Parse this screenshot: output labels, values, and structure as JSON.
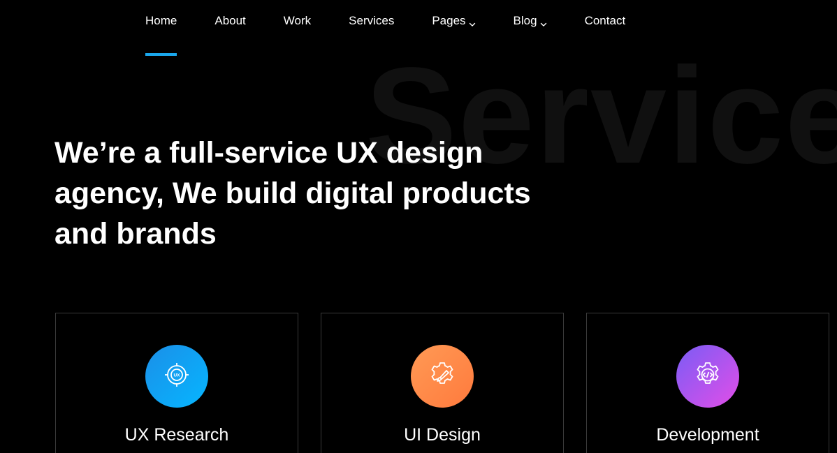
{
  "nav": {
    "items": [
      {
        "label": "Home",
        "active": true,
        "dropdown": false
      },
      {
        "label": "About",
        "active": false,
        "dropdown": false
      },
      {
        "label": "Work",
        "active": false,
        "dropdown": false
      },
      {
        "label": "Services",
        "active": false,
        "dropdown": false
      },
      {
        "label": "Pages",
        "active": false,
        "dropdown": true
      },
      {
        "label": "Blog",
        "active": false,
        "dropdown": true
      },
      {
        "label": "Contact",
        "active": false,
        "dropdown": false
      }
    ],
    "accent_color": "#1aa7ec"
  },
  "hero": {
    "watermark": "Services",
    "title": "We’re a full-service UX design agency, We build digital products and brands"
  },
  "services": [
    {
      "title": "UX Research",
      "icon": "ux-target-icon",
      "gradient": [
        "#1b8fe8",
        "#06b6ff"
      ]
    },
    {
      "title": "UI Design",
      "icon": "gear-brush-icon",
      "gradient": [
        "#ff9a55",
        "#ff7a3d"
      ]
    },
    {
      "title": "Development",
      "icon": "gear-code-icon",
      "gradient": [
        "#7a5cf5",
        "#e24ee8"
      ]
    }
  ]
}
